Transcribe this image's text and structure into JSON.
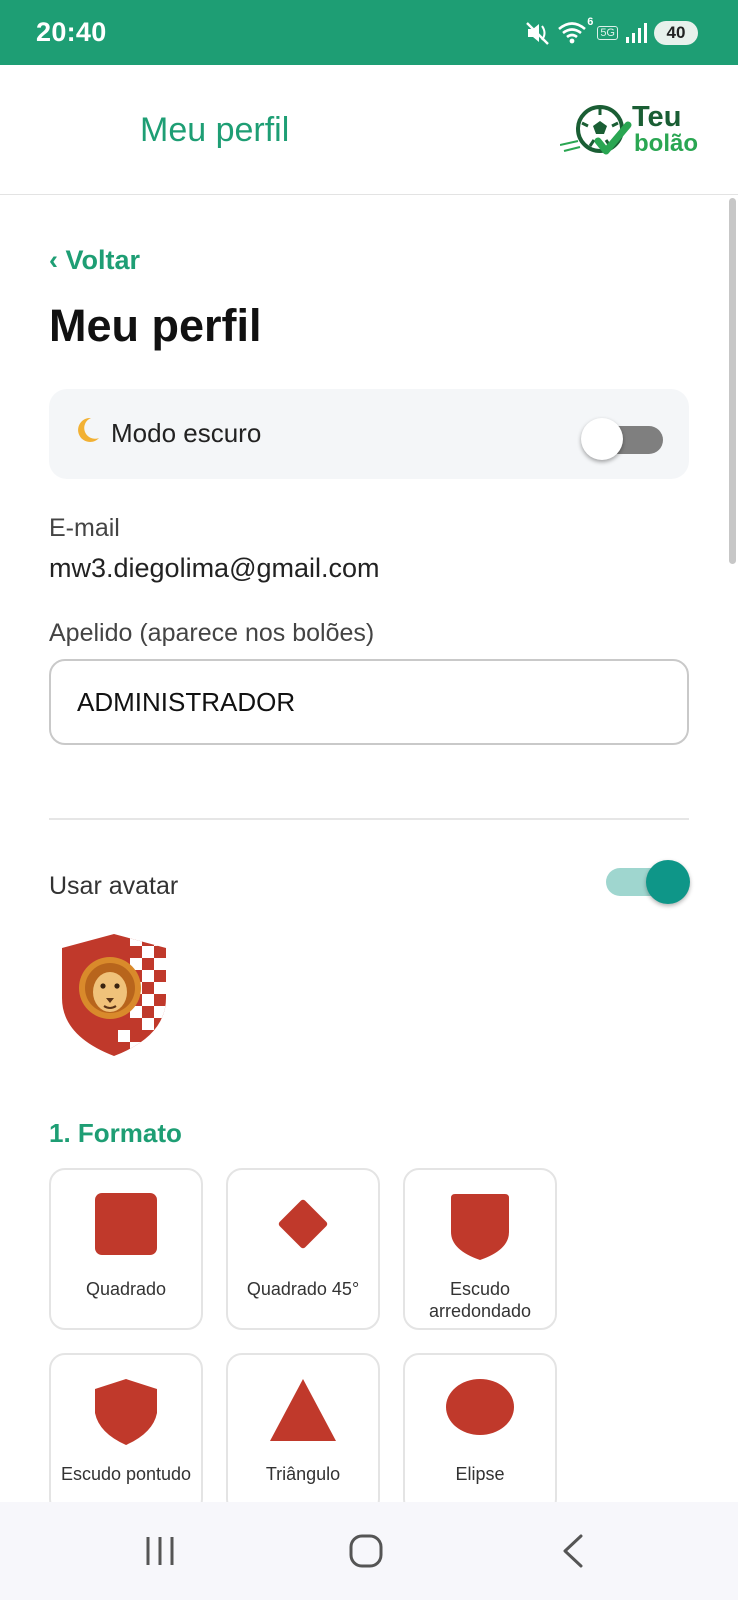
{
  "status_bar": {
    "time": "20:40",
    "battery": "40",
    "wifi_badge": "6",
    "network": "5G",
    "icons": [
      "mute-icon",
      "wifi-icon",
      "signal-icon",
      "battery-icon"
    ]
  },
  "header": {
    "title": "Meu perfil",
    "logo": {
      "line1": "Teu",
      "line2": "bolão"
    }
  },
  "page": {
    "back_label": "‹ Voltar",
    "title": "Meu perfil"
  },
  "dark_mode": {
    "icon": "🌙",
    "label": "Modo escuro",
    "enabled": false
  },
  "email": {
    "label": "E-mail",
    "value": "mw3.diegolima@gmail.com"
  },
  "nickname": {
    "label": "Apelido (aparece nos bolões)",
    "value": "ADMINISTRADOR"
  },
  "avatar": {
    "label": "Usar avatar",
    "enabled": true
  },
  "format_section": {
    "title": "1. Formato",
    "options": [
      {
        "shape": "square",
        "label": "Quadrado"
      },
      {
        "shape": "diamond",
        "label": "Quadrado 45°"
      },
      {
        "shape": "rounded-shield",
        "label": "Escudo arredondado"
      },
      {
        "shape": "pointed-shield",
        "label": "Escudo pontudo"
      },
      {
        "shape": "triangle",
        "label": "Triângulo"
      },
      {
        "shape": "ellipse",
        "label": "Elipse"
      }
    ]
  },
  "colors": {
    "primary": "#1e9e74",
    "shape_red": "#c0392b",
    "toggle_on": "#0e9688"
  },
  "navigation": {
    "buttons": [
      "recent-apps-button",
      "home-button",
      "back-button"
    ]
  }
}
